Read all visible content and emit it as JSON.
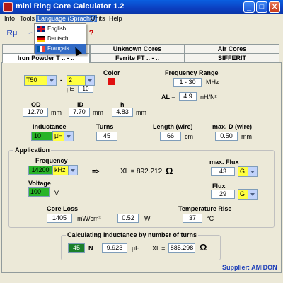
{
  "window": {
    "title": "mini Ring Core Calculator 1.2",
    "min": "_",
    "max": "□",
    "close": "X"
  },
  "menu": {
    "info": "Info",
    "tools": "Tools",
    "language": "Language (Sprache)",
    "units": "Units",
    "help": "Help"
  },
  "language_menu": [
    {
      "label": "English"
    },
    {
      "label": "Deutsch"
    },
    {
      "label": "Français"
    }
  ],
  "toolbar": {
    "help_glyph": "?"
  },
  "tabs": {
    "row1": [
      "Fe",
      "Unknown Cores",
      "Air Cores"
    ],
    "row2": [
      "Iron Powder T .. - ..",
      "Ferrite FT .. - ..",
      "SIFFERIT"
    ]
  },
  "core": {
    "type": "T50",
    "dash": "-",
    "mix": "2",
    "mu_label": "µi=",
    "mu_value": "10",
    "color_label": "Color",
    "color": "#e01010"
  },
  "freq_range": {
    "label": "Frequency Range",
    "value": "1 - 30",
    "unit": "MHz"
  },
  "al": {
    "label": "AL =",
    "value": "4.9",
    "unit": "nH/N²"
  },
  "dims": {
    "od_label": "OD",
    "od_value": "12.70",
    "od_unit": "mm",
    "id_label": "ID",
    "id_value": "7.70",
    "id_unit": "mm",
    "h_label": "h",
    "h_value": "4.83",
    "h_unit": "mm"
  },
  "inductance": {
    "label": "Inductance",
    "value": "10",
    "unit": "µH"
  },
  "turns": {
    "label": "Turns",
    "value": "45"
  },
  "length": {
    "label": "Length (wire)",
    "value": "66",
    "unit": "cm"
  },
  "maxd": {
    "label": "max. D (wire)",
    "value": "0.50",
    "unit": "mm"
  },
  "application": {
    "title": "Application",
    "freq_label": "Frequency",
    "freq_value": "14200",
    "freq_unit": "kHz",
    "arrow": "=>",
    "xl_label": "XL =",
    "xl_value": "892.212",
    "ohm": "Ω",
    "maxflux_label": "max. Flux",
    "maxflux_value": "43",
    "maxflux_unit": "G",
    "voltage_label": "Voltage",
    "voltage_value": "100",
    "voltage_unit": "V",
    "flux_label": "Flux",
    "flux_value": "29",
    "flux_unit": "G",
    "coreloss_label": "Core Loss",
    "coreloss_value": "1405",
    "coreloss_unit": "mW/cm³",
    "watts_value": "0.52",
    "watts_unit": "W",
    "temp_label": "Temperature Rise",
    "temp_value": "37",
    "temp_unit": "°C"
  },
  "calc": {
    "title": "Calculating inductance by number of turns",
    "n_value": "45",
    "n_unit": "N",
    "uh_value": "9.923",
    "uh_unit": "µH",
    "xl_label": "XL =",
    "xl_value": "885.298",
    "ohm": "Ω"
  },
  "supplier": "Supplier: AMIDON"
}
